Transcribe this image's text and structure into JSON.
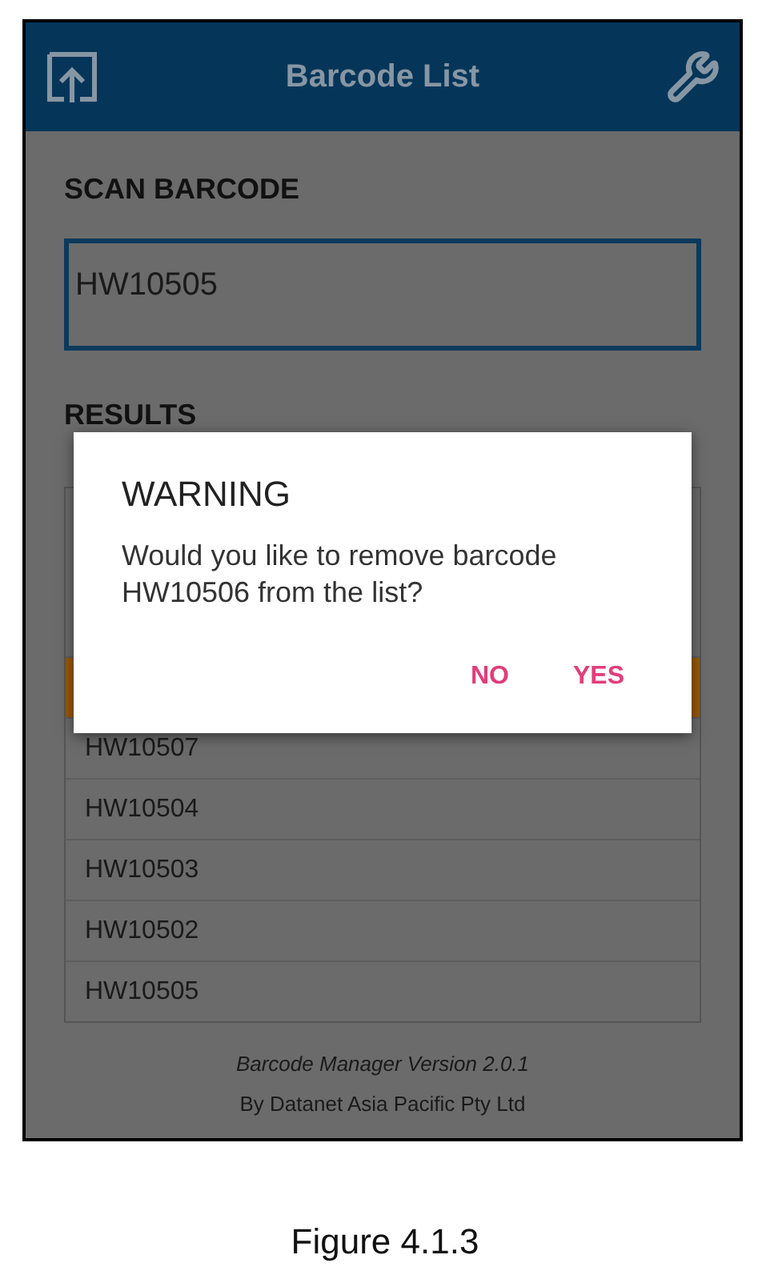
{
  "header": {
    "title": "Barcode List"
  },
  "scan": {
    "label": "SCAN BARCODE",
    "value": "HW10505"
  },
  "results": {
    "label": "RESULTS",
    "rows": [
      {
        "selected": true
      },
      {
        "label": "HW10507",
        "selected": false
      },
      {
        "label": "HW10504",
        "selected": false
      },
      {
        "label": "HW10503",
        "selected": false
      },
      {
        "label": "HW10502",
        "selected": false
      },
      {
        "label": "HW10505",
        "selected": false
      }
    ]
  },
  "footer": {
    "version": "Barcode Manager Version 2.0.1",
    "company": "By Datanet Asia Pacific Pty Ltd"
  },
  "dialog": {
    "title": "WARNING",
    "message": "Would you like to remove barcode HW10506 from the list?",
    "buttons": [
      "NO",
      "YES"
    ]
  },
  "caption": "Figure 4.1.3"
}
